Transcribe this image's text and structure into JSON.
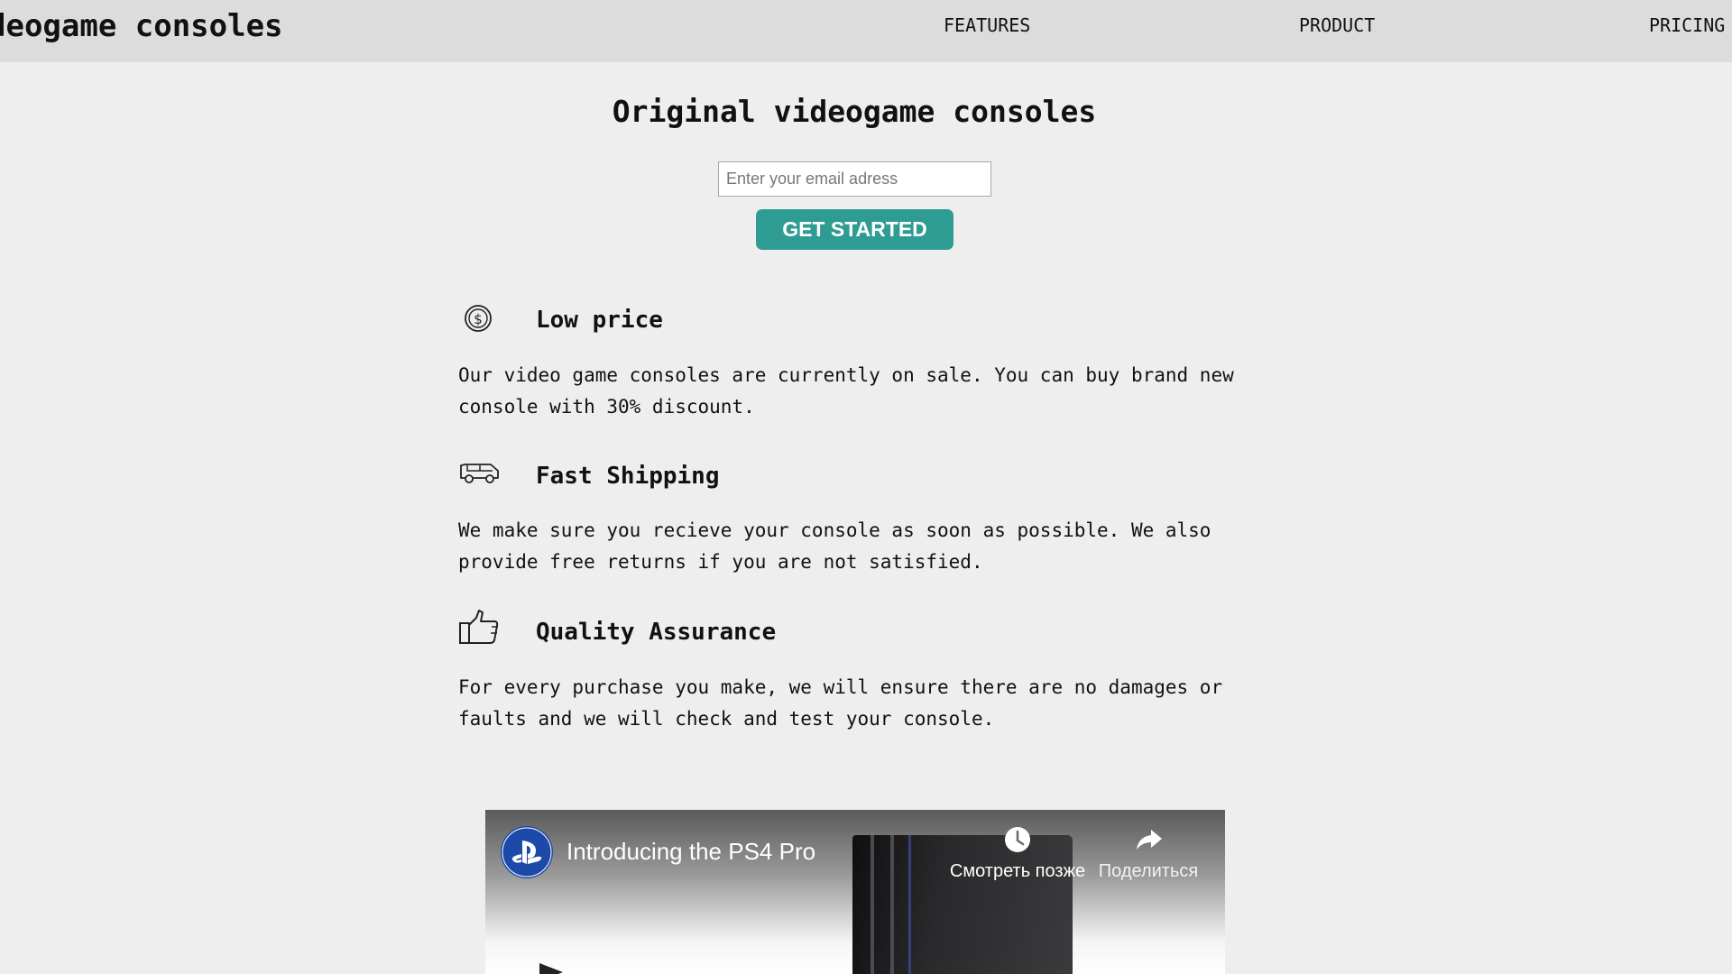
{
  "header": {
    "logo": "deogame consoles",
    "nav": [
      {
        "label": "FEATURES"
      },
      {
        "label": "PRODUCT"
      },
      {
        "label": "PRICING"
      }
    ]
  },
  "hero": {
    "title": "Original videogame consoles",
    "email_placeholder": "Enter your email adress",
    "email_value": "",
    "cta_label": "GET STARTED",
    "cta_color": "#2f9c93"
  },
  "features": [
    {
      "icon": "dollar-coin-icon",
      "title": "Low price",
      "description_lines": [
        "Our video game consoles are currently on sale. You can buy brand new",
        "console with 30% discount."
      ]
    },
    {
      "icon": "truck-icon",
      "title": "Fast Shipping",
      "description_lines": [
        "We make sure you recieve your console as soon as possible. We also",
        "provide free returns if you are not satisfied."
      ]
    },
    {
      "icon": "thumbs-up-icon",
      "title": "Quality Assurance",
      "description_lines": [
        "For every purchase you make, we will ensure there are no damages or",
        "faults and we will check and test your console."
      ]
    }
  ],
  "video": {
    "title": "Introducing the PS4 Pro",
    "watch_later_label": "Смотреть позже",
    "share_label": "Поделиться",
    "channel_logo": "playstation-logo-icon"
  }
}
